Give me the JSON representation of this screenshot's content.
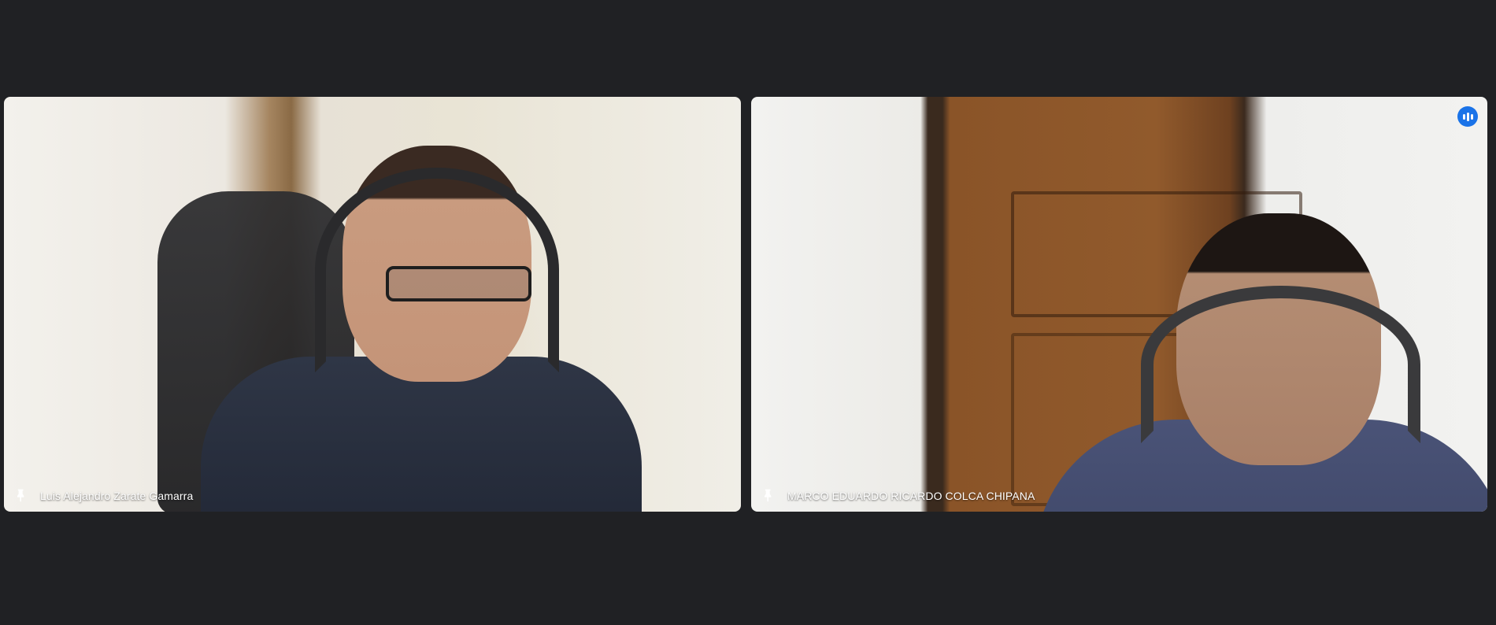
{
  "participants": [
    {
      "name": "Luis Alejandro Zarate Gamarra",
      "pin_icon": "pin-icon",
      "speaking": false
    },
    {
      "name": "MARCO EDUARDO RICARDO COLCA CHIPANA",
      "pin_icon": "pin-icon",
      "speaking": true,
      "speaking_icon": "audio-level-icon"
    }
  ],
  "colors": {
    "background": "#202124",
    "speaking_accent": "#1a73e8",
    "label_text": "#ffffff"
  }
}
